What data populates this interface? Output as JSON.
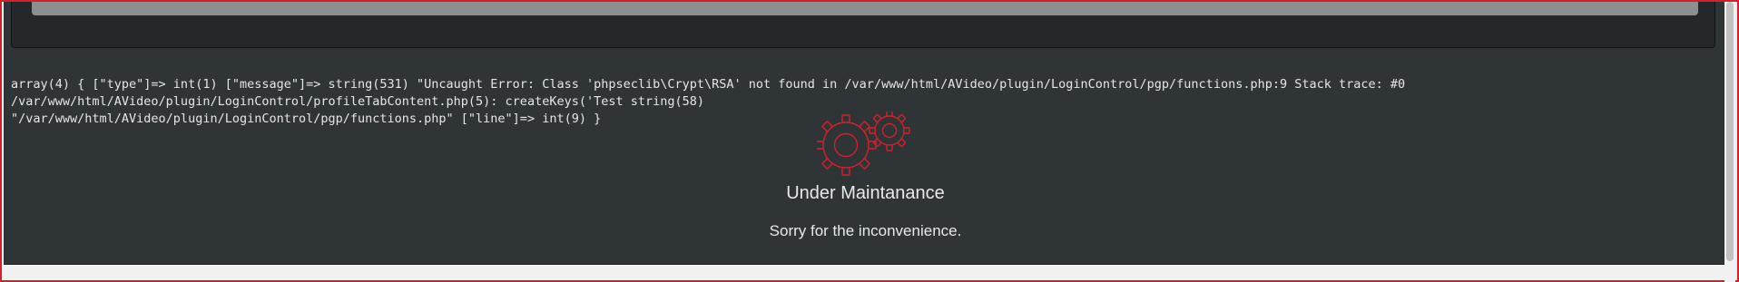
{
  "error": {
    "message": "array(4) { [\"type\"]=> int(1) [\"message\"]=> string(531) \"Uncaught Error: Class 'phpseclib\\Crypt\\RSA' not found in /var/www/html/AVideo/plugin/LoginControl/pgp/functions.php:9 Stack trace: #0 /var/www/html/AVideo/plugin/LoginControl/profileTabContent.php(5): createKeys('Test string(58)\n\"/var/www/html/AVideo/plugin/LoginControl/pgp/functions.php\" [\"line\"]=> int(9) }"
  },
  "maintenance": {
    "icon": "gears-icon",
    "title": "Under Maintanance",
    "subtitle": "Sorry for the inconvenience."
  },
  "colors": {
    "accent_red": "#d4202a",
    "panel_bg": "#2f3437",
    "text": "#e6e6e6"
  }
}
